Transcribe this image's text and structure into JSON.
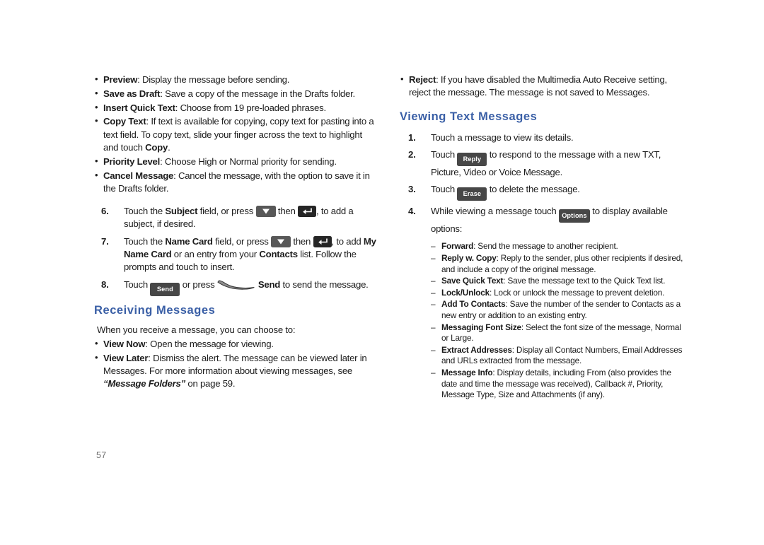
{
  "document": {
    "page_number": "57",
    "heading_color": "#3a5fa6",
    "button_color": "#474747"
  },
  "left_column": {
    "compose_options": [
      {
        "term": "Preview",
        "sep": ": ",
        "text": "Display the message before sending."
      },
      {
        "term": "Save as Draft",
        "sep": ": ",
        "text": "Save a copy of the message in the Drafts folder."
      },
      {
        "term": "Insert Quick Text",
        "sep": ": ",
        "text": "Choose from 19 pre-loaded phrases."
      },
      {
        "term": "Copy Text",
        "sep": ": ",
        "text": "If text is available for copying, copy text for pasting into a text field. To copy text, slide your finger across the text to highlight and touch ",
        "term_tail": "Copy",
        "tail": "."
      },
      {
        "term": "Priority Level",
        "sep": ": ",
        "text": "Choose High or Normal priority for sending."
      },
      {
        "term": "Cancel Message",
        "sep": ": ",
        "text": "Cancel the message, with the option to save it in the Drafts folder."
      }
    ],
    "steps": {
      "step6": {
        "num": "6.",
        "part1": "Touch the ",
        "bold1": "Subject",
        "part2": " field, or press ",
        "key1": "navigation-down-key",
        "part3": " then ",
        "key2": "enter-key",
        "part4": ", to add a subject, if desired."
      },
      "step7": {
        "num": "7.",
        "part1": "Touch the ",
        "bold1": "Name Card",
        "part2": " field, or press ",
        "key1": "navigation-down-key",
        "part3": " then ",
        "key2": "enter-key",
        "part4": ", to add ",
        "bold2": "My Name Card",
        "part5": " or an entry from your ",
        "bold3": "Contacts",
        "part6": " list. Follow the prompts and touch to insert."
      },
      "step8": {
        "num": "8.",
        "part1": "Touch ",
        "button_label": "Send",
        "part2": " or press ",
        "softkey": "send-soft-key",
        "sp": " ",
        "bold1": "Send",
        "part3": " to send the message."
      }
    },
    "receiving_messages": {
      "heading": "Receiving Messages",
      "intro": "When you receive a message, you can choose to:",
      "items": [
        {
          "term": "View Now",
          "sep": ": ",
          "text": "Open the message for viewing."
        },
        {
          "term": "View Later",
          "sep": ": ",
          "text": "Dismiss the alert. The message can be viewed later in Messages. For more information about viewing messages, see ",
          "italic": "“Message Folders”",
          "tail": " on page 59."
        }
      ]
    }
  },
  "right_column": {
    "reject_option": {
      "term": "Reject",
      "sep": ": ",
      "text": "If you have disabled the Multimedia Auto Receive setting, reject the message. The message is not saved to Messages."
    },
    "viewing_text_messages": {
      "heading": "Viewing Text Messages",
      "steps": {
        "step1": {
          "num": "1.",
          "text": "Touch a message to view its details."
        },
        "step2": {
          "num": "2.",
          "part1": "Touch ",
          "button_label": "Reply",
          "part2": " to respond to the message with a new TXT, Picture, Video or Voice Message."
        },
        "step3": {
          "num": "3.",
          "part1": "Touch ",
          "button_label": "Erase",
          "part2": " to delete the message."
        },
        "step4": {
          "num": "4.",
          "part1": "While viewing a message touch ",
          "button_label": "Options",
          "part2": " to display available options:"
        }
      },
      "options": [
        {
          "term": "Forward",
          "sep": ": ",
          "text": "Send the message to another recipient."
        },
        {
          "term": "Reply w. Copy",
          "sep": ": ",
          "text": "Reply to the sender, plus other recipients if desired, and include a copy of the original message."
        },
        {
          "term": "Save Quick Text",
          "sep": ": ",
          "text": "Save the message text to the Quick Text list."
        },
        {
          "term": "Lock/Unlock",
          "sep": ": ",
          "text": "Lock or unlock the message to prevent deletion."
        },
        {
          "term": "Add To Contacts",
          "sep": ": ",
          "text": "Save the number of the sender to Contacts as a new entry or addition to an existing entry."
        },
        {
          "term": "Messaging Font Size",
          "sep": ": ",
          "text": "Select the font size of the message, Normal or Large."
        },
        {
          "term": "Extract Addresses",
          "sep": ": ",
          "text": "Display all Contact Numbers, Email Addresses and URLs extracted from the message."
        },
        {
          "term": "Message Info",
          "sep": ": ",
          "text": "Display details, including From (also provides the date and time the message was received), Callback #, Priority, Message Type, Size and Attachments (if any)."
        }
      ]
    }
  }
}
